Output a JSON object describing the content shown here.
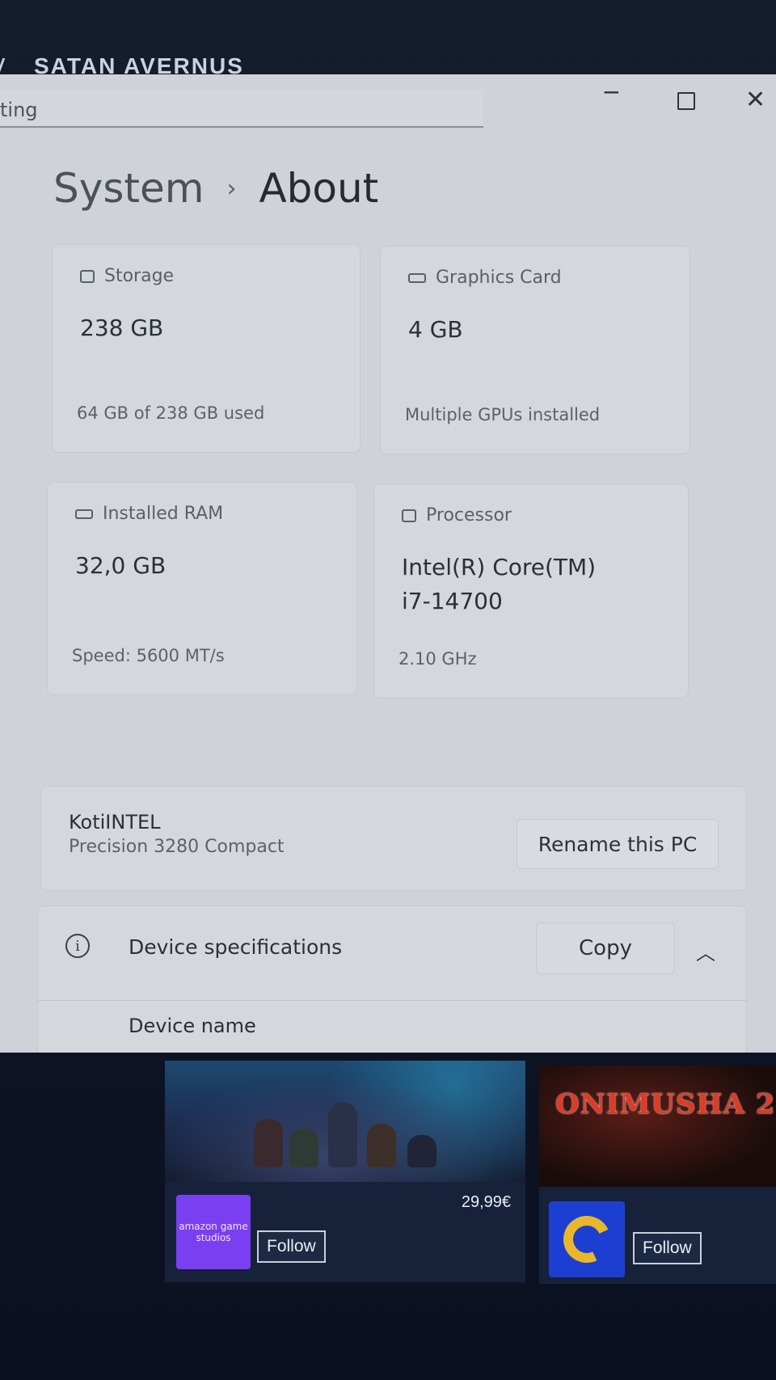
{
  "background_app": {
    "title": "SATAN AVERNUS",
    "cards": [
      {
        "price": "29,99€",
        "publisher_logo_text": "amazon game studios",
        "follow_label": "Follow"
      },
      {
        "game_title_art": "ONIMUSHA 2",
        "follow_label": "Follow"
      }
    ]
  },
  "window": {
    "search_text": "ting",
    "controls": {
      "minimize": "─",
      "maximize": "",
      "close": "✕"
    }
  },
  "breadcrumb": {
    "parent": "System",
    "separator": "›",
    "current": "About"
  },
  "specs": {
    "storage": {
      "label": "Storage",
      "value": "238 GB",
      "detail": "64 GB of 238 GB used"
    },
    "graphics": {
      "label": "Graphics Card",
      "value": "4 GB",
      "detail": "Multiple GPUs installed"
    },
    "ram": {
      "label": "Installed RAM",
      "value": "32,0 GB",
      "detail": "Speed: 5600 MT/s"
    },
    "processor": {
      "label": "Processor",
      "value_line1": "Intel(R) Core(TM)",
      "value_line2": "i7-14700",
      "detail": "2.10 GHz"
    }
  },
  "pc": {
    "name": "KotiINTEL",
    "model": "Precision 3280 Compact",
    "rename_label": "Rename this PC"
  },
  "device_specs": {
    "title": "Device specifications",
    "copy_label": "Copy",
    "first_row_label": "Device name"
  },
  "colors": {
    "window_bg": "#cfd3d9",
    "amazon_purple": "#7b3ff2",
    "capcom_blue": "#1d3fd1",
    "capcom_yellow": "#e9b82a"
  }
}
